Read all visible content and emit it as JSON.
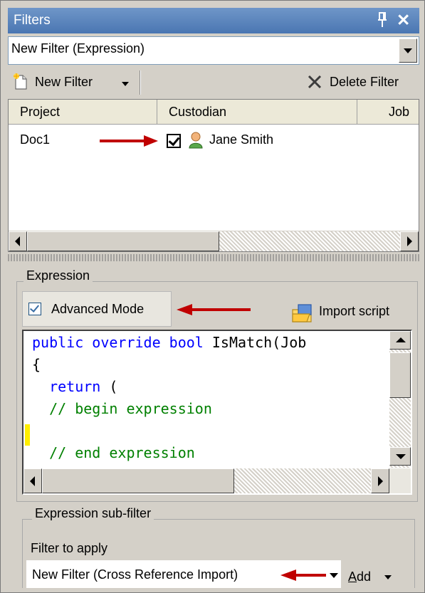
{
  "window": {
    "title": "Filters",
    "pin_icon": "pin-icon",
    "close_icon": "close-icon",
    "close_glyph": "✕"
  },
  "filter_select": {
    "value": "New Filter (Expression)"
  },
  "toolbar": {
    "new_filter_label": "New Filter",
    "new_filter_icon": "new-document-icon",
    "delete_filter_label": "Delete Filter",
    "delete_icon": "x-icon"
  },
  "grid": {
    "columns": [
      "Project",
      "Custodian",
      "Job"
    ],
    "rows": [
      {
        "project": "Doc1",
        "custodian_checked": true,
        "custodian": "Jane Smith",
        "custodian_icon": "person-icon"
      }
    ]
  },
  "expression": {
    "legend": "Expression",
    "advanced_mode_label": "Advanced Mode",
    "advanced_mode_checked": true,
    "import_script_label": "Import script",
    "import_icon": "folder-import-icon",
    "code_lines": [
      {
        "parts": [
          [
            "kw",
            "public override bool"
          ],
          [
            "tx",
            " IsMatch(Job"
          ]
        ]
      },
      {
        "parts": [
          [
            "tx",
            "{"
          ]
        ]
      },
      {
        "parts": [
          [
            "tx",
            "  "
          ],
          [
            "kw",
            "return"
          ],
          [
            "tx",
            " ("
          ]
        ]
      },
      {
        "parts": [
          [
            "tx",
            "  "
          ],
          [
            "cm",
            "// begin expression"
          ]
        ]
      },
      {
        "parts": []
      },
      {
        "parts": [
          [
            "tx",
            "  "
          ],
          [
            "cm",
            "// end expression"
          ]
        ]
      }
    ]
  },
  "sub_filter": {
    "legend": "Expression sub-filter",
    "filter_to_apply_label": "Filter to apply",
    "selected": "New Filter (Cross Reference Import)",
    "add_label": "Add",
    "add_accesskey": "A",
    "add_rest": "dd"
  },
  "colors": {
    "title_bar": "#4a76b2",
    "annotation_arrow": "#c00000",
    "keyword": "#0000ff",
    "comment": "#008000",
    "caret_highlight": "#ffee00"
  }
}
